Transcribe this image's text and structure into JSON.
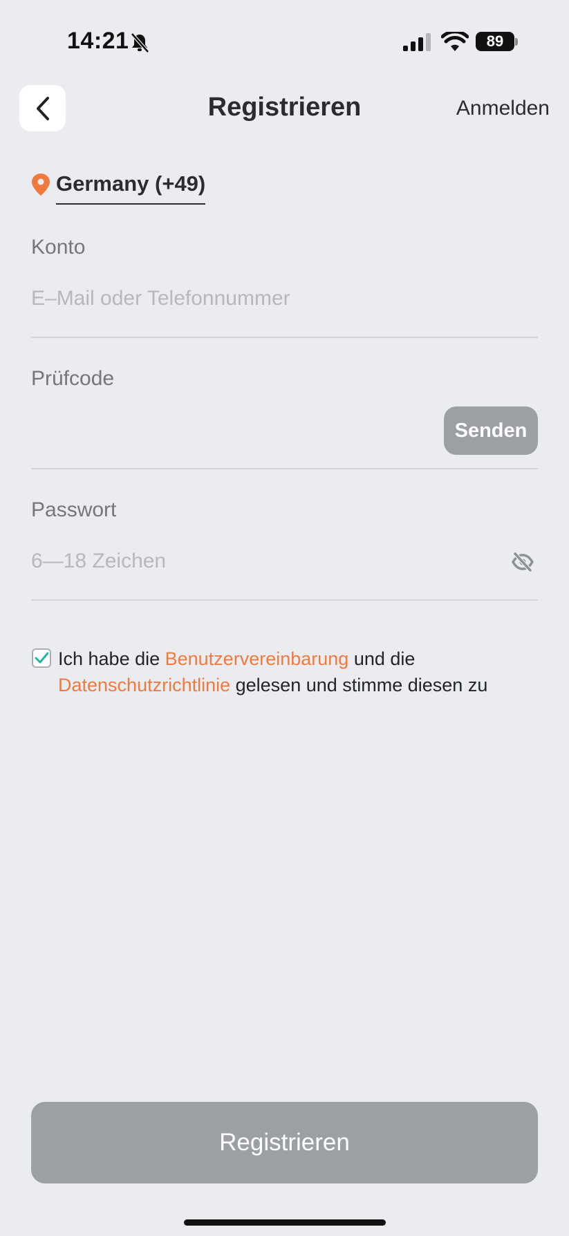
{
  "status_bar": {
    "time": "14:21",
    "battery": "89",
    "icons": [
      "bell-off-icon",
      "signal-icon",
      "wifi-icon",
      "battery-icon"
    ]
  },
  "header": {
    "title": "Registrieren",
    "login_label": "Anmelden",
    "back_icon": "chevron-left-icon"
  },
  "country": {
    "label": "Germany (+49)",
    "icon": "location-pin-icon"
  },
  "form": {
    "account": {
      "label": "Konto",
      "placeholder": "E–Mail oder Telefonnummer",
      "value": ""
    },
    "code": {
      "label": "Prüfcode",
      "value": "",
      "send_label": "Senden"
    },
    "password": {
      "label": "Passwort",
      "placeholder": "6—18 Zeichen",
      "value": "",
      "toggle_icon": "eye-off-icon"
    }
  },
  "agreement": {
    "checked": true,
    "text_1": "Ich habe die ",
    "link_1": "Benutzervereinbarung",
    "text_2": " und die ",
    "link_2": "Datenschutzrichtlinie",
    "text_3": " gelesen und stimme diesen zu"
  },
  "submit": {
    "label": "Registrieren"
  },
  "colors": {
    "background": "#ebecf0",
    "accent": "#f07a3e",
    "check": "#1fb5a4",
    "disabled_button": "#9c9fa4"
  }
}
